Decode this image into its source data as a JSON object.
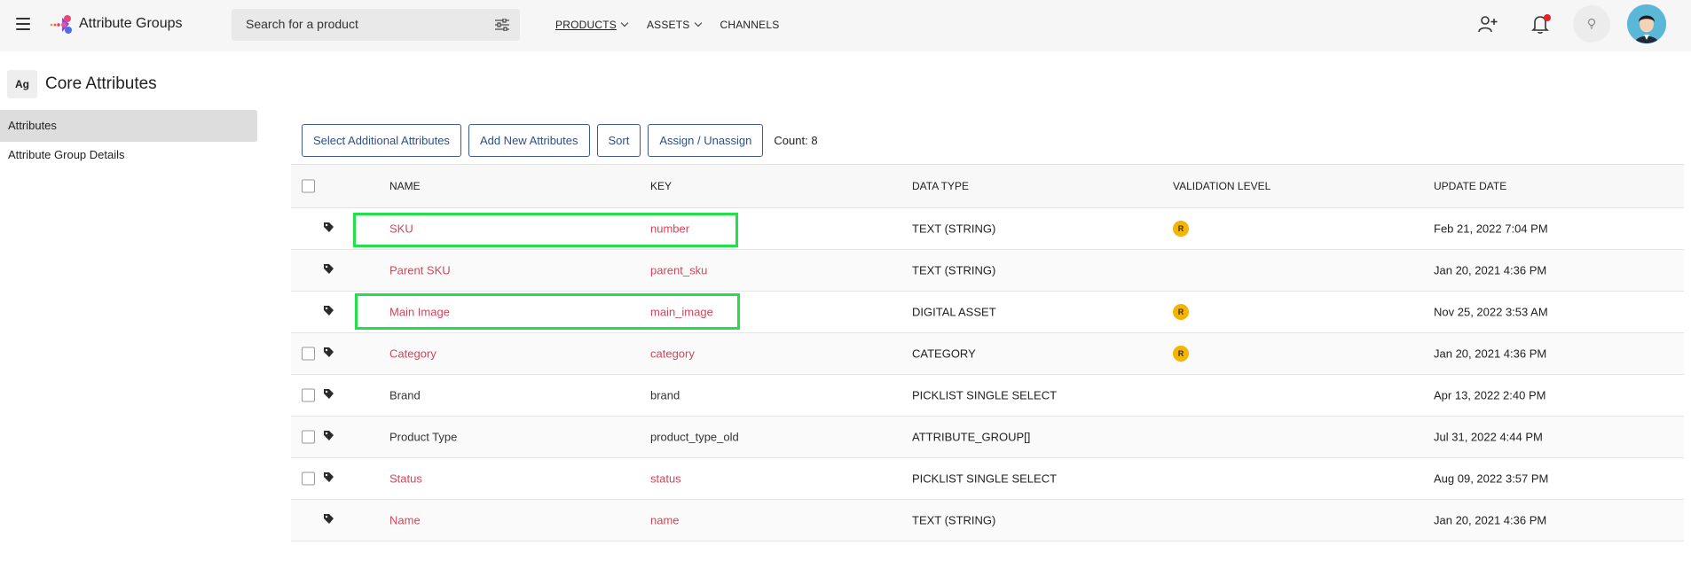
{
  "app": {
    "title": "Attribute Groups"
  },
  "search": {
    "placeholder": "Search for a product"
  },
  "nav": [
    {
      "label": "PRODUCTS",
      "has_dropdown": true,
      "active": true
    },
    {
      "label": "ASSETS",
      "has_dropdown": true,
      "active": false
    },
    {
      "label": "CHANNELS",
      "has_dropdown": false,
      "active": false
    }
  ],
  "header_icons": [
    "add-user-icon",
    "bell-icon",
    "help-icon",
    "avatar"
  ],
  "page": {
    "badge": "Ag",
    "title": "Core Attributes"
  },
  "sidebar": {
    "items": [
      {
        "label": "Attributes",
        "active": true
      },
      {
        "label": "Attribute Group Details",
        "active": false
      }
    ]
  },
  "toolbar": {
    "buttons": [
      "Select Additional Attributes",
      "Add New Attributes",
      "Sort",
      "Assign / Unassign"
    ],
    "count": "Count: 8"
  },
  "table": {
    "columns": [
      "NAME",
      "KEY",
      "DATA TYPE",
      "VALIDATION LEVEL",
      "UPDATE DATE"
    ],
    "rows": [
      {
        "name": "SKU",
        "key": "number",
        "type": "TEXT (STRING)",
        "validation": "R",
        "date": "Feb 21, 2022 7:04 PM",
        "checkbox": false,
        "style": "red"
      },
      {
        "name": "Parent SKU",
        "key": "parent_sku",
        "type": "TEXT (STRING)",
        "validation": "",
        "date": "Jan 20, 2021 4:36 PM",
        "checkbox": false,
        "style": "red"
      },
      {
        "name": "Main Image",
        "key": "main_image",
        "type": "DIGITAL ASSET",
        "validation": "R",
        "date": "Nov 25, 2022 3:53 AM",
        "checkbox": false,
        "style": "red"
      },
      {
        "name": "Category",
        "key": "category",
        "type": "CATEGORY",
        "validation": "R",
        "date": "Jan 20, 2021 4:36 PM",
        "checkbox": true,
        "style": "red"
      },
      {
        "name": "Brand",
        "key": "brand",
        "type": "PICKLIST SINGLE SELECT",
        "validation": "",
        "date": "Apr 13, 2022 2:40 PM",
        "checkbox": true,
        "style": "dark"
      },
      {
        "name": "Product Type",
        "key": "product_type_old",
        "type": "ATTRIBUTE_GROUP[]",
        "validation": "",
        "date": "Jul 31, 2022 4:44 PM",
        "checkbox": true,
        "style": "dark"
      },
      {
        "name": "Status",
        "key": "status",
        "type": "PICKLIST SINGLE SELECT",
        "validation": "",
        "date": "Aug 09, 2022 3:57 PM",
        "checkbox": true,
        "style": "red"
      },
      {
        "name": "Name",
        "key": "name",
        "type": "TEXT (STRING)",
        "validation": "",
        "date": "Jan 20, 2021 4:36 PM",
        "checkbox": false,
        "style": "red"
      }
    ]
  },
  "colors": {
    "accent_red": "#d0475a",
    "button_blue": "#2f4f86",
    "highlight_green": "#22e04a",
    "badge_yellow": "#f4b400"
  }
}
